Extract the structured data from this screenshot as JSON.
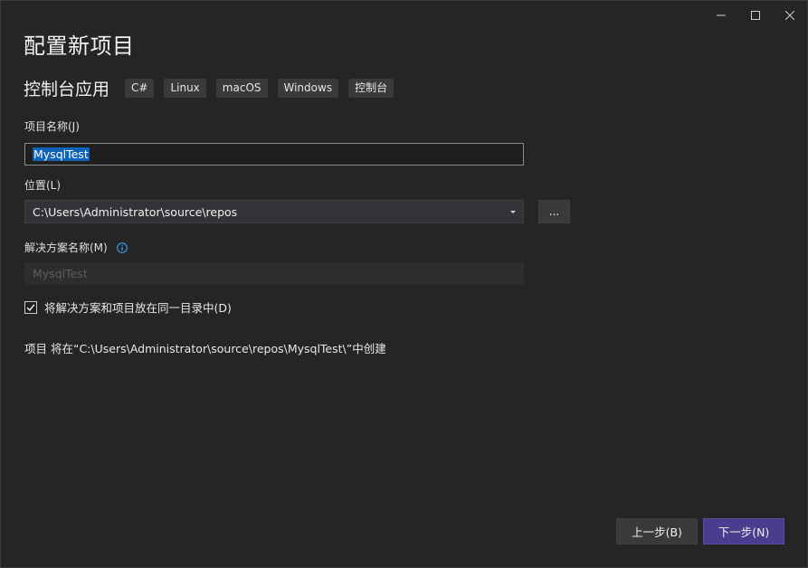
{
  "window": {
    "minimize_icon": "minimize-icon",
    "maximize_icon": "maximize-icon",
    "close_icon": "close-icon"
  },
  "dialog": {
    "title": "配置新项目"
  },
  "template": {
    "name": "控制台应用",
    "tags": [
      "C#",
      "Linux",
      "macOS",
      "Windows",
      "控制台"
    ]
  },
  "project_name": {
    "label": "项目名称(J)",
    "value": "MysqlTest"
  },
  "location": {
    "label": "位置(L)",
    "value": "C:\\Users\\Administrator\\source\\repos",
    "browse_label": "..."
  },
  "solution_name": {
    "label": "解决方案名称(M)",
    "placeholder": "MysqlTest",
    "info_icon": "info-icon"
  },
  "same_directory": {
    "label": "将解决方案和项目放在同一目录中(D)",
    "checked": true
  },
  "path_note": "项目 将在“C:\\Users\\Administrator\\source\\repos\\MysqlTest\\”中创建",
  "footer": {
    "back_label": "上一步(B)",
    "next_label": "下一步(N)"
  },
  "colors": {
    "background": "#252526",
    "accent_button": "#493d8e",
    "selection": "#0e63b8",
    "info_icon": "#3aa0f0"
  }
}
